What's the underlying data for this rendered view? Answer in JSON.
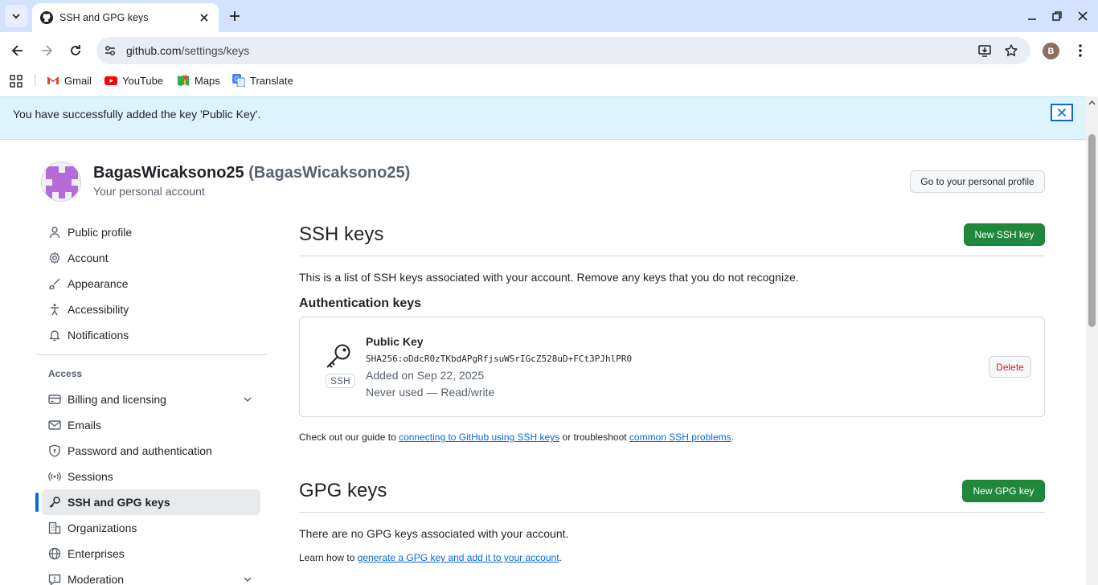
{
  "browser": {
    "tab_title": "SSH and GPG keys",
    "url_host": "github.com",
    "url_path": "/settings/keys",
    "profile_initial": "B",
    "bookmarks": [
      {
        "label": "Gmail"
      },
      {
        "label": "YouTube"
      },
      {
        "label": "Maps"
      },
      {
        "label": "Translate"
      }
    ]
  },
  "flash": {
    "message": "You have successfully added the key 'Public Key'."
  },
  "account": {
    "name": "BagasWicaksono25",
    "login": "(BagasWicaksono25)",
    "subtitle": "Your personal account",
    "profile_button": "Go to your personal profile"
  },
  "sidebar": {
    "items": [
      {
        "label": "Public profile"
      },
      {
        "label": "Account"
      },
      {
        "label": "Appearance"
      },
      {
        "label": "Accessibility"
      },
      {
        "label": "Notifications"
      }
    ],
    "access_heading": "Access",
    "access_items": [
      {
        "label": "Billing and licensing"
      },
      {
        "label": "Emails"
      },
      {
        "label": "Password and authentication"
      },
      {
        "label": "Sessions"
      },
      {
        "label": "SSH and GPG keys"
      },
      {
        "label": "Organizations"
      },
      {
        "label": "Enterprises"
      },
      {
        "label": "Moderation"
      }
    ]
  },
  "ssh": {
    "title": "SSH keys",
    "new_button": "New SSH key",
    "description": "This is a list of SSH keys associated with your account. Remove any keys that you do not recognize.",
    "auth_heading": "Authentication keys",
    "key": {
      "title": "Public Key",
      "fingerprint": "SHA256:oDdcR0zTKbdAPgRfjsuWSrIGcZ528uD+FCt3PJhlPR0",
      "added": "Added on Sep 22, 2025",
      "usage": "Never used — Read/write",
      "type_badge": "SSH",
      "delete_button": "Delete"
    },
    "guide_prefix": "Check out our guide to ",
    "guide_link1": "connecting to GitHub using SSH keys",
    "guide_middle": " or troubleshoot ",
    "guide_link2": "common SSH problems",
    "guide_suffix": "."
  },
  "gpg": {
    "title": "GPG keys",
    "new_button": "New GPG key",
    "empty_text": "There are no GPG keys associated with your account.",
    "learn_prefix": "Learn how to ",
    "learn_link": "generate a GPG key and add it to your account",
    "learn_suffix": "."
  },
  "colors": {
    "accent": "#0969da",
    "primary_button": "#1f883d",
    "danger": "#d1242f",
    "flash_bg": "#ddf4ff"
  }
}
